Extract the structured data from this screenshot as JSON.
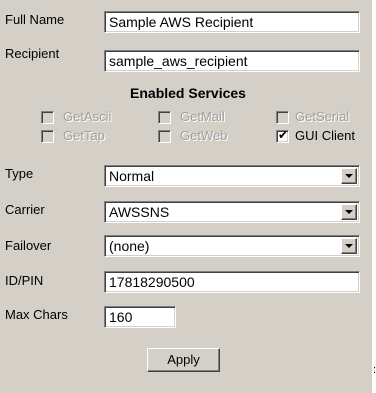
{
  "form": {
    "full_name_label": "Full Name",
    "full_name_value": "Sample AWS Recipient",
    "recipient_label": "Recipient",
    "recipient_value": "sample_aws_recipient",
    "enabled_services_title": "Enabled Services",
    "services": [
      {
        "label": "GetAscii",
        "checked": false,
        "enabled": false
      },
      {
        "label": "GetMail",
        "checked": false,
        "enabled": false
      },
      {
        "label": "GetSerial",
        "checked": false,
        "enabled": false
      },
      {
        "label": "GetTap",
        "checked": false,
        "enabled": false
      },
      {
        "label": "GetWeb",
        "checked": false,
        "enabled": false
      },
      {
        "label": "GUI Client",
        "checked": true,
        "enabled": true
      }
    ],
    "type_label": "Type",
    "type_value": "Normal",
    "carrier_label": "Carrier",
    "carrier_value": "AWSSNS",
    "failover_label": "Failover",
    "failover_value": "(none)",
    "idpin_label": "ID/PIN",
    "idpin_value": "17818290500",
    "maxchars_label": "Max Chars",
    "maxchars_value": "160",
    "apply_label": "Apply",
    "check_glyph": "✔"
  },
  "colors": {
    "panel_bg": "#d4d0c8",
    "field_bg": "#ffffff",
    "disabled_text": "#a0a0a0"
  }
}
